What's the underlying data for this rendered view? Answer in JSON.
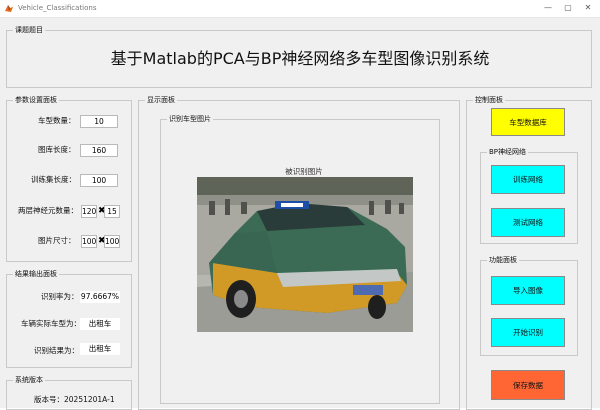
{
  "window": {
    "title": "Vehicle_Classifications"
  },
  "title_panel": {
    "label": "课题题目",
    "text": "基于Matlab的PCA与BP神经网络多车型图像识别系统"
  },
  "params_panel": {
    "label": "参数设置面板",
    "vehicle_count_label": "车型数量：",
    "vehicle_count": "10",
    "library_length_label": "图库长度：",
    "library_length": "160",
    "training_length_label": "训练集长度：",
    "training_length": "100",
    "neurons_label": "两层神经元数量：",
    "neurons_1": "120",
    "neurons_2": "15",
    "image_size_label": "图片尺寸：",
    "image_size_1": "100",
    "image_size_2": "100",
    "times_symbol": "✖"
  },
  "results_panel": {
    "label": "结果输出面板",
    "recognition_rate_label": "识别率为：",
    "recognition_rate": "97.6667%",
    "actual_type_label": "车辆实际车型为：",
    "actual_type": "出租车",
    "result_label": "识别结果为：",
    "result": "出租车"
  },
  "version_panel": {
    "label": "系统版本",
    "text": "版本号：20251201A-1"
  },
  "display_panel": {
    "label": "显示面板",
    "image_group_label": "识别车型图片",
    "image_title": "被识别图片"
  },
  "control_panel": {
    "label": "控制面板",
    "vehicle_db_button": "车型数据库",
    "bp_label": "BP神经网络",
    "train_button": "训练网络",
    "test_button": "测试网络",
    "func_label": "功能面板",
    "import_button": "导入图像",
    "recognize_button": "开始识别",
    "save_button": "保存数据"
  },
  "colors": {
    "yellow": "#ffff00",
    "cyan": "#00ffff",
    "orange": "#ff6633",
    "figure_bg": "#f0f0f0"
  }
}
